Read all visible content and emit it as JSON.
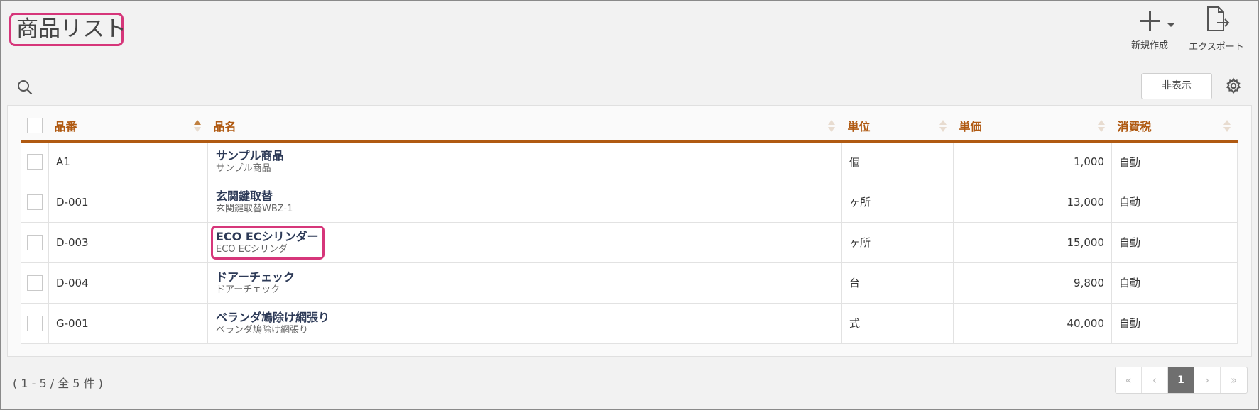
{
  "page": {
    "title": "商品リスト"
  },
  "toolbar": {
    "new_label": "新規作成",
    "export_label": "エクスポート",
    "hide_label": "非表示"
  },
  "icons": {
    "search": "search-icon",
    "settings": "gear-icon",
    "new": "plus-icon",
    "export": "export-icon"
  },
  "colors": {
    "accent": "#b05a12",
    "highlight": "#d6367a",
    "product_name": "#2d3a57"
  },
  "table": {
    "columns": [
      "品番",
      "品名",
      "単位",
      "単価",
      "消費税"
    ],
    "sorted_column": "品番",
    "sort_direction": "asc",
    "rows": [
      {
        "code": "A1",
        "name": "サンプル商品",
        "subname": "サンプル商品",
        "unit": "個",
        "price": "1,000",
        "tax": "自動"
      },
      {
        "code": "D-001",
        "name": "玄関鍵取替",
        "subname": "玄関鍵取替WBZ-1",
        "unit": "ヶ所",
        "price": "13,000",
        "tax": "自動"
      },
      {
        "code": "D-003",
        "name": "ECO ECシリンダー",
        "subname": "ECO ECシリンダ",
        "unit": "ヶ所",
        "price": "15,000",
        "tax": "自動"
      },
      {
        "code": "D-004",
        "name": "ドアーチェック",
        "subname": "ドアーチェック",
        "unit": "台",
        "price": "9,800",
        "tax": "自動"
      },
      {
        "code": "G-001",
        "name": "ベランダ鳩除け網張り",
        "subname": "ベランダ鳩除け網張り",
        "unit": "式",
        "price": "40,000",
        "tax": "自動"
      }
    ]
  },
  "pagination": {
    "summary": "( 1 - 5 / 全 5 件 )",
    "first": "«",
    "prev": "‹",
    "current": "1",
    "next": "›",
    "last": "»"
  }
}
